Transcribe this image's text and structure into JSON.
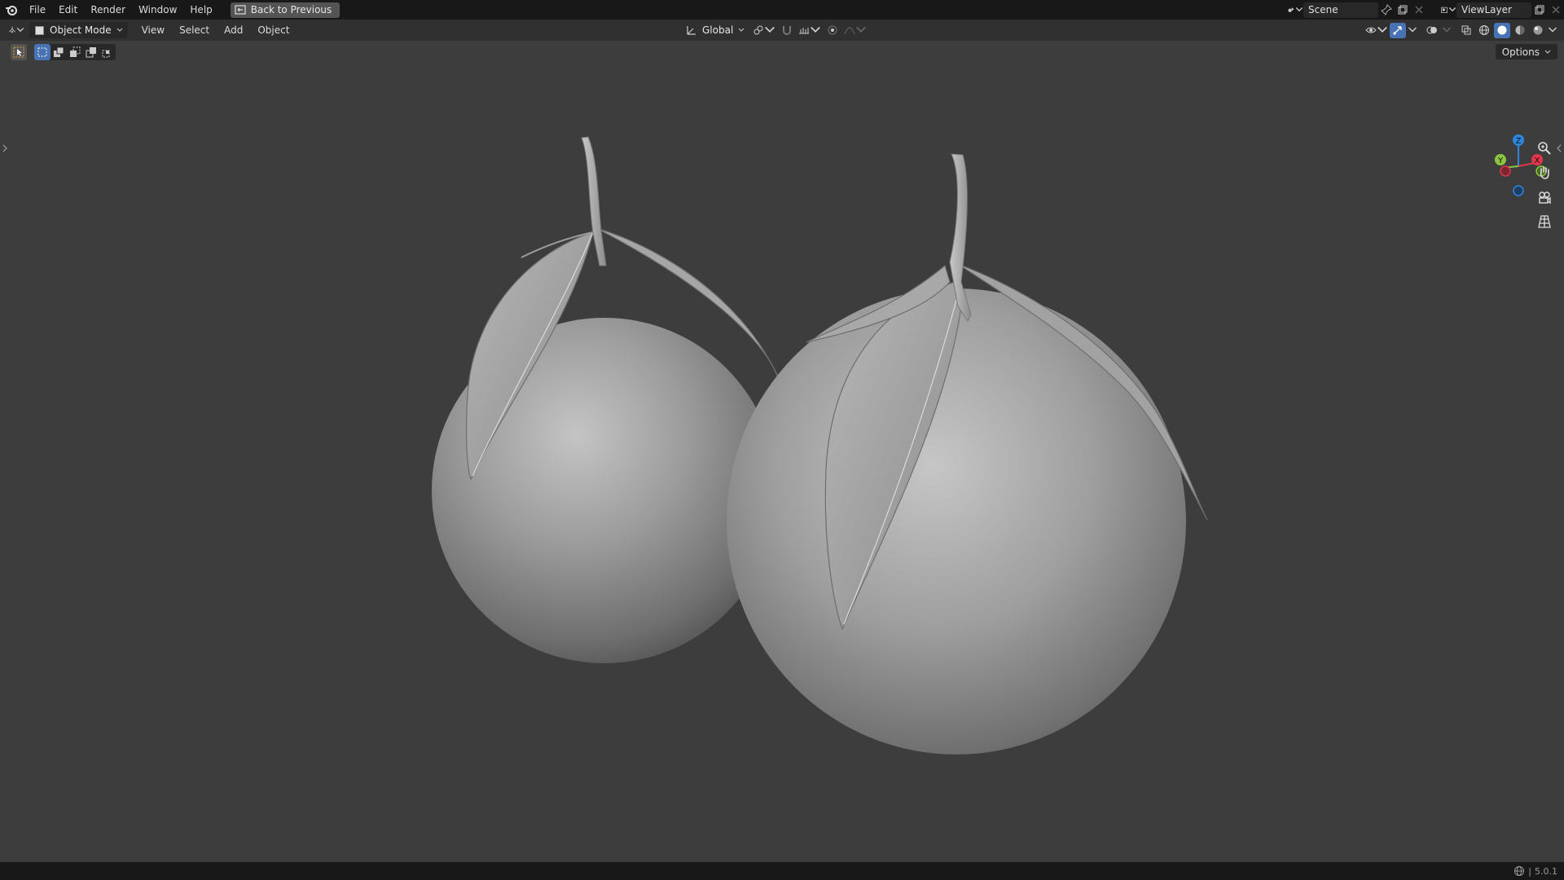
{
  "app": {
    "menus": [
      "File",
      "Edit",
      "Render",
      "Window",
      "Help"
    ],
    "back_button": "Back to Previous",
    "scene_name": "Scene",
    "view_layer": "ViewLayer"
  },
  "header": {
    "mode": "Object Mode",
    "menus": [
      "View",
      "Select",
      "Add",
      "Object"
    ],
    "orientation": "Global"
  },
  "toolbar": {
    "options_label": "Options"
  },
  "gizmo": {
    "axes": [
      "Z",
      "Y",
      "X"
    ],
    "colors": {
      "x": "#e2364a",
      "y": "#8bc53f",
      "z": "#2e86de"
    }
  },
  "status": {
    "version": "5.0.1"
  },
  "colors": {
    "viewport_bg": "#3d3d3d",
    "topbar_bg": "#181818",
    "header_bg": "#303030",
    "accent": "#4772b3"
  }
}
